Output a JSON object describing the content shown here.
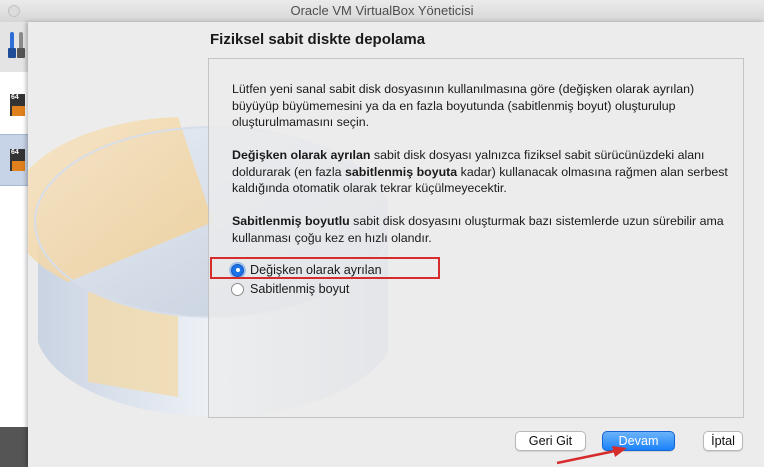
{
  "window": {
    "title": "Oracle VM VirtualBox Yöneticisi"
  },
  "background": {
    "vm_items": [
      {
        "badge": "64"
      },
      {
        "badge": "64"
      }
    ]
  },
  "dialog": {
    "title": "Fiziksel sabit diskte depolama",
    "intro": "Lütfen yeni sanal sabit disk dosyasının kullanılmasına göre (değişken olarak ayrılan) büyüyüp büyümemesini ya da en fazla boyutunda (sabitlenmiş boyut) oluşturulup oluşturulmamasını seçin.",
    "dynamic_para": {
      "bold_lead": "Değişken olarak ayrılan",
      "text_1": " sabit disk dosyası yalnızca fiziksel sabit sürücünüzdeki alanı doldurarak (en fazla ",
      "bold_mid": "sabitlenmiş boyuta",
      "text_2": " kadar) kullanacak olmasına rağmen alan serbest kaldığında otomatik olarak tekrar küçülmeyecektir."
    },
    "fixed_para": {
      "bold_lead": "Sabitlenmiş boyutlu",
      "text": " sabit disk dosyasını oluşturmak bazı sistemlerde uzun sürebilir ama kullanması çoğu kez en hızlı olandır."
    },
    "options": [
      {
        "label": "Değişken olarak ayrılan",
        "selected": true
      },
      {
        "label": "Sabitlenmiş boyut",
        "selected": false
      }
    ],
    "buttons": {
      "back": "Geri Git",
      "continue": "Devam",
      "cancel": "İptal"
    }
  },
  "colors": {
    "accent": "#1a82fb",
    "highlight": "#d62c2c"
  }
}
